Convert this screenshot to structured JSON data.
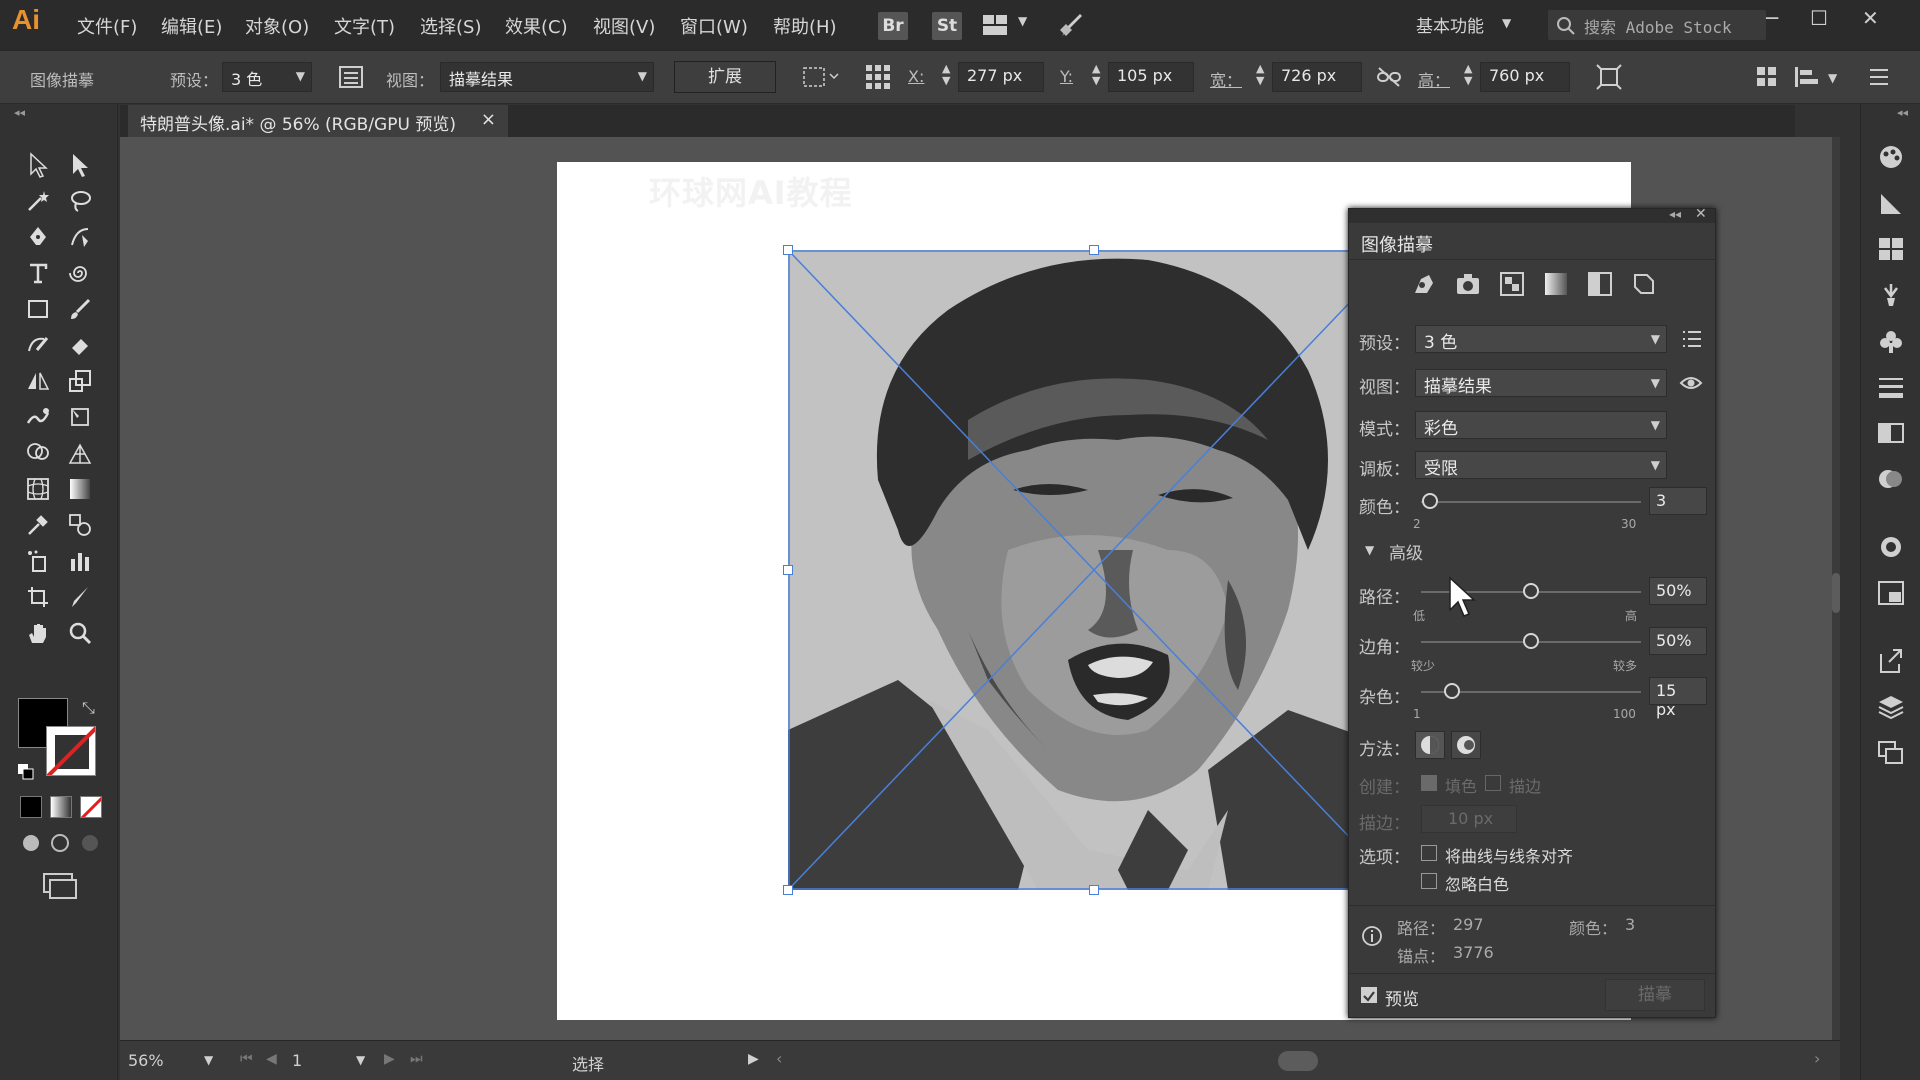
{
  "app": {
    "logo": "Ai"
  },
  "menu": [
    "文件(F)",
    "编辑(E)",
    "对象(O)",
    "文字(T)",
    "选择(S)",
    "效果(C)",
    "视图(V)",
    "窗口(W)",
    "帮助(H)"
  ],
  "bridge_buttons": [
    "Br",
    "St"
  ],
  "workspace": "基本功能",
  "search_placeholder": "搜索 Adobe Stock",
  "control_bar": {
    "panel_name": "图像描摹",
    "preset_label": "预设：",
    "preset_value": "3 色",
    "view_label": "视图：",
    "view_value": "描摹结果",
    "expand_button": "扩展",
    "x_label": "X:",
    "x_value": "277 px",
    "y_label": "Y:",
    "y_value": "105 px",
    "w_label": "宽：",
    "w_value": "726 px",
    "h_label": "高：",
    "h_value": "760 px"
  },
  "document_tab": {
    "title": "特朗普头像.ai* @ 56% (RGB/GPU 预览)",
    "close": "×"
  },
  "artboard_watermark": "环球网AI教程",
  "trace_panel": {
    "title": "图像描摹",
    "preset_label": "预设：",
    "preset_value": "3 色",
    "view_label": "视图：",
    "view_value": "描摹结果",
    "mode_label": "模式：",
    "mode_value": "彩色",
    "palette_label": "调板：",
    "palette_value": "受限",
    "colors_label": "颜色：",
    "colors_value": "3",
    "colors_min": "2",
    "colors_max": "30",
    "advanced_label": "高级",
    "paths_label": "路径：",
    "paths_value": "50%",
    "paths_low": "低",
    "paths_high": "高",
    "corners_label": "边角：",
    "corners_value": "50%",
    "corners_low": "较少",
    "corners_high": "较多",
    "noise_label": "杂色：",
    "noise_value": "15 px",
    "noise_min": "1",
    "noise_max": "100",
    "method_label": "方法：",
    "create_label": "创建：",
    "create_fill": "填色",
    "create_stroke": "描边",
    "stroke_label": "描边：",
    "stroke_value": "10 px",
    "options_label": "选项：",
    "snap_curves": "将曲线与线条对齐",
    "ignore_white": "忽略白色",
    "stat_paths_label": "路径：",
    "stat_paths_value": "297",
    "stat_colors_label": "颜色：",
    "stat_colors_value": "3",
    "stat_anchors_label": "锚点：",
    "stat_anchors_value": "3776",
    "preview_label": "预览",
    "trace_button": "描摹",
    "sliders": {
      "colors": 0.04,
      "paths": 0.5,
      "corners": 0.5,
      "noise": 0.14
    }
  },
  "statusbar": {
    "zoom": "56%",
    "page": "1",
    "tool": "选择"
  },
  "colors": {
    "accent": "#e8912f",
    "selection": "#4a7fd8"
  }
}
